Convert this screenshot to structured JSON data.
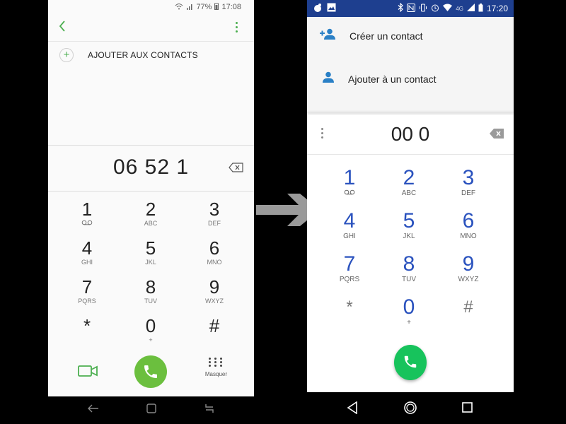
{
  "left_phone": {
    "status": {
      "battery": "77%",
      "time": "17:08"
    },
    "add_to_contacts": "AJOUTER AUX CONTACTS",
    "dialed_number": "06 52 1",
    "keys": [
      {
        "digit": "1",
        "letters": ""
      },
      {
        "digit": "2",
        "letters": "ABC"
      },
      {
        "digit": "3",
        "letters": "DEF"
      },
      {
        "digit": "4",
        "letters": "GHI"
      },
      {
        "digit": "5",
        "letters": "JKL"
      },
      {
        "digit": "6",
        "letters": "MNO"
      },
      {
        "digit": "7",
        "letters": "PQRS"
      },
      {
        "digit": "8",
        "letters": "TUV"
      },
      {
        "digit": "9",
        "letters": "WXYZ"
      },
      {
        "digit": "*",
        "letters": ""
      },
      {
        "digit": "0",
        "letters": "+"
      },
      {
        "digit": "#",
        "letters": ""
      }
    ],
    "hide_label": "Masquer",
    "accent_color": "#4caf50"
  },
  "right_phone": {
    "status": {
      "network": "4G",
      "time": "17:20"
    },
    "create_contact": "Créer un contact",
    "add_to_contact": "Ajouter à un contact",
    "dialed_number": "00 0",
    "keys": [
      {
        "digit": "1",
        "letters": ""
      },
      {
        "digit": "2",
        "letters": "ABC"
      },
      {
        "digit": "3",
        "letters": "DEF"
      },
      {
        "digit": "4",
        "letters": "GHI"
      },
      {
        "digit": "5",
        "letters": "JKL"
      },
      {
        "digit": "6",
        "letters": "MNO"
      },
      {
        "digit": "7",
        "letters": "PQRS"
      },
      {
        "digit": "8",
        "letters": "TUV"
      },
      {
        "digit": "9",
        "letters": "WXYZ"
      },
      {
        "digit": "*",
        "letters": ""
      },
      {
        "digit": "0",
        "letters": "+"
      },
      {
        "digit": "#",
        "letters": ""
      }
    ],
    "accent_color": "#2a52be",
    "call_color": "#17c35c"
  }
}
